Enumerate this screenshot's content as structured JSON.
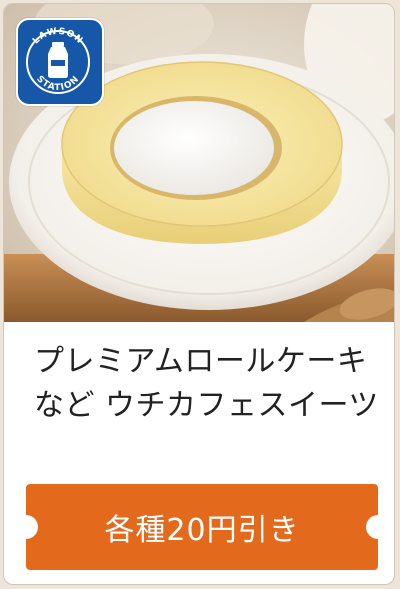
{
  "brand": {
    "logo_text_top": "LAWSON",
    "logo_text_bottom": "STATION",
    "logo_color": "#1657a7"
  },
  "product": {
    "image_alt": "roll cake photo",
    "title": "プレミアムロールケーキなど ウチカフェスイーツ"
  },
  "coupon": {
    "label": "各種20円引き",
    "color": "#e36a1d"
  }
}
